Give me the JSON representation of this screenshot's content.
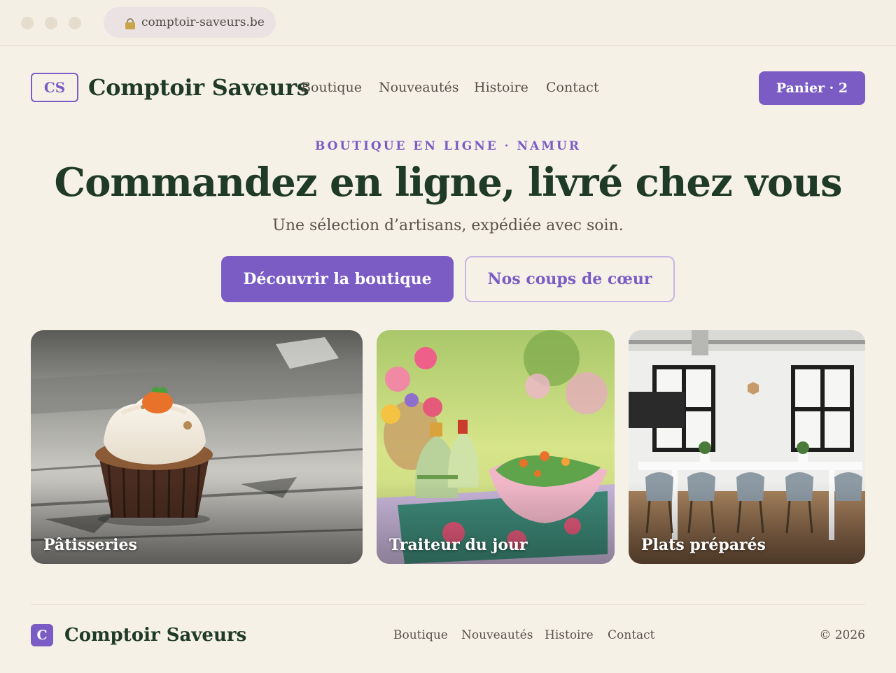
{
  "browser": {
    "url": "comptoir-saveurs.be",
    "lock_icon": "lock-icon"
  },
  "header": {
    "logo_initials": "CS",
    "brand": "Comptoir Saveurs",
    "nav": [
      "Boutique",
      "Nouveautés",
      "Histoire",
      "Contact"
    ],
    "cart_label": "Panier · 2"
  },
  "hero": {
    "eyebrow": "BOUTIQUE EN LIGNE · NAMUR",
    "title": "Commandez en ligne, livré chez vous",
    "subtitle": "Une sélection d’artisans, expédiée avec soin.",
    "primary_cta": "Découvrir la boutique",
    "secondary_cta": "Nos coups de cœur"
  },
  "categories": [
    {
      "label": "Pâtisseries",
      "image": "cupcake-photo"
    },
    {
      "label": "Traiteur du jour",
      "image": "salad-table-photo"
    },
    {
      "label": "Plats préparés",
      "image": "dining-room-photo"
    }
  ],
  "footer": {
    "logo_initial": "C",
    "brand": "Comptoir Saveurs",
    "nav": [
      "Boutique",
      "Nouveautés",
      "Histoire",
      "Contact"
    ],
    "copyright": "© 2026"
  },
  "colors": {
    "accent": "#7b5cc4",
    "brand_text": "#1f3a26",
    "background": "#f6f1e7"
  }
}
